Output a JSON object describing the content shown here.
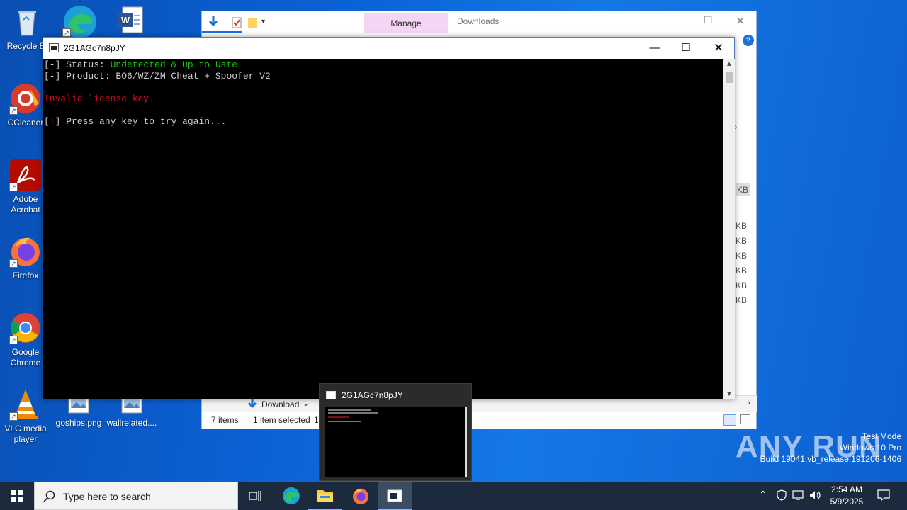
{
  "desktop": {
    "icons": [
      {
        "label": "Recycle Bin",
        "display": "Recycle Bi"
      },
      {
        "label": "CCleaner",
        "display": "CCleaner"
      },
      {
        "label": "Adobe Acrobat",
        "display": "Adobe Acrobat"
      },
      {
        "label": "Firefox",
        "display": "Firefox"
      },
      {
        "label": "Google Chrome",
        "display": "Google Chrome"
      },
      {
        "label": "VLC media player",
        "display": "VLC media player"
      },
      {
        "label": "goships.png",
        "display": "goships.png"
      },
      {
        "label": "wallrelated....",
        "display": "wallrelated...."
      }
    ]
  },
  "explorer": {
    "manage_tab": "Manage",
    "title": "Downloads",
    "size_unit": "KB",
    "download_label": "Download",
    "status_items": "7 items",
    "status_selected": "1 item selected",
    "status_size": "19",
    "help": "?"
  },
  "console": {
    "title": "2G1AGc7n8pJY",
    "line1_prefix": "[-] Status: ",
    "line1_value": "Undetected & Up to Date",
    "line2": "[-] Product: BO6/WZ/ZM Cheat + Spoofer V2",
    "error": "Invalid license key.",
    "line4_open": "[",
    "line4_bang": "!",
    "line4_rest": "] Press any key to try again...",
    "colors": {
      "green": "#16c60c",
      "red": "#c50f1f"
    }
  },
  "thumbnail": {
    "title": "2G1AGc7n8pJY"
  },
  "watermark": {
    "brand": "ANY RUN",
    "mode": "Test Mode",
    "os": "Windows 10 Pro",
    "build": "Build 19041.vb_release.191206-1406"
  },
  "taskbar": {
    "search_placeholder": "Type here to search",
    "time": "2:54 AM",
    "date": "5/9/2025"
  }
}
